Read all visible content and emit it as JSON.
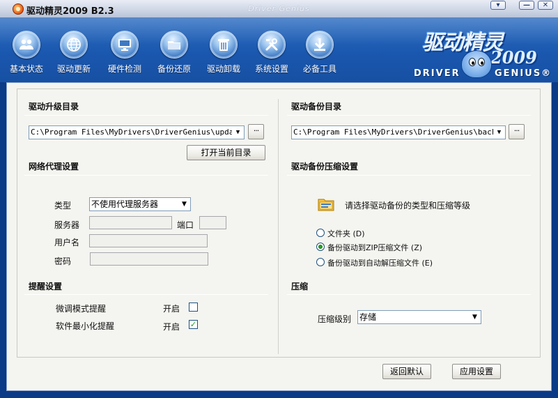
{
  "window": {
    "title": "驱动精灵2009 B2.3",
    "brand": "Driver Genius",
    "buttons": {
      "minimize": "▾",
      "restore": "—",
      "close": "✕"
    }
  },
  "toolbar": [
    {
      "label": "基本状态",
      "icon": "users-icon"
    },
    {
      "label": "驱动更新",
      "icon": "globe-icon"
    },
    {
      "label": "硬件检测",
      "icon": "monitor-icon"
    },
    {
      "label": "备份还原",
      "icon": "folder-icon"
    },
    {
      "label": "驱动卸载",
      "icon": "trash-icon"
    },
    {
      "label": "系统设置",
      "icon": "tools-icon"
    },
    {
      "label": "必备工具",
      "icon": "download-icon"
    }
  ],
  "logo": {
    "name": "驱动精灵",
    "year": "2009",
    "left_word": "DRIVER",
    "right_word": "GENIUS®"
  },
  "upgrade_dir": {
    "title": "驱动升级目录",
    "path": "C:\\Program Files\\MyDrivers\\DriverGenius\\update",
    "browse_label": "···",
    "open_label": "打开当前目录"
  },
  "proxy": {
    "title": "网络代理设置",
    "type_label": "类型",
    "type_value": "不使用代理服务器",
    "server_label": "服务器",
    "port_label": "端口",
    "user_label": "用户名",
    "password_label": "密码"
  },
  "reminder": {
    "title": "提醒设置",
    "items": [
      {
        "label": "微调模式提醒",
        "state_label": "开启",
        "checked": false
      },
      {
        "label": "软件最小化提醒",
        "state_label": "开启",
        "checked": true
      }
    ]
  },
  "backup_dir": {
    "title": "驱动备份目录",
    "path": "C:\\Program Files\\MyDrivers\\DriverGenius\\backup",
    "browse_label": "···"
  },
  "backup_compress": {
    "title": "驱动备份压缩设置",
    "hint": "请选择驱动备份的类型和压缩等级",
    "options": [
      {
        "label": "文件夹 (D)",
        "selected": false
      },
      {
        "label": "备份驱动到ZIP压缩文件 (Z)",
        "selected": true
      },
      {
        "label": "备份驱动到自动解压缩文件 (E)",
        "selected": false
      }
    ]
  },
  "compress": {
    "title": "压缩",
    "level_label": "压缩级别",
    "level_value": "存储"
  },
  "footer": {
    "reset_label": "返回默认",
    "apply_label": "应用设置"
  },
  "colors": {
    "header": "#1a57ae",
    "check": "#21a121",
    "panel_bg": "#f4f4f0"
  }
}
